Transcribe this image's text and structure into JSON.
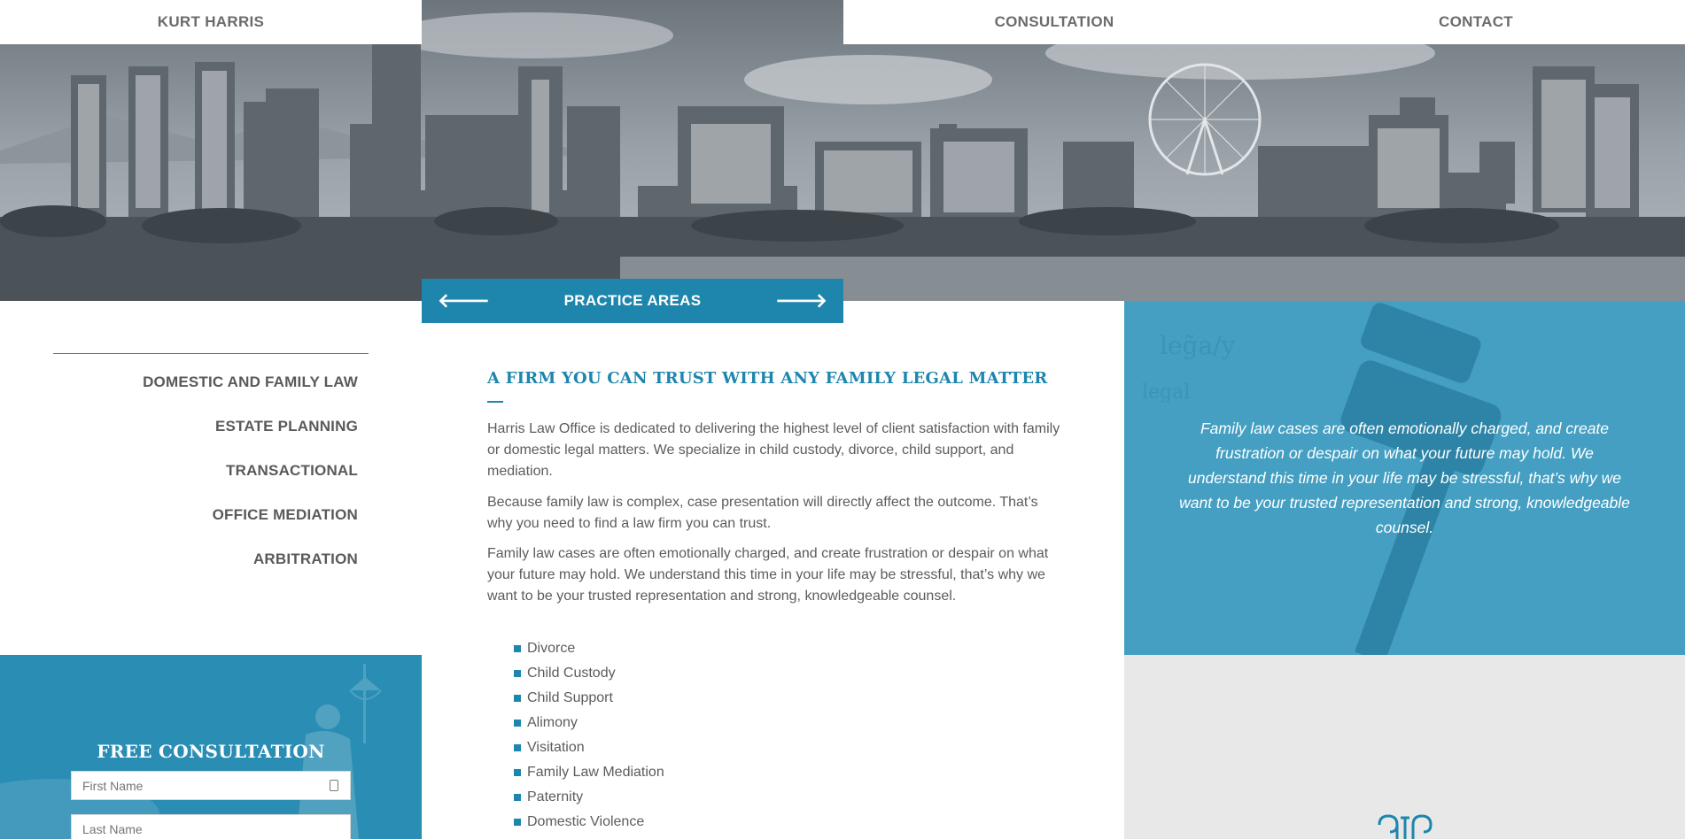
{
  "nav": {
    "brand": "KURT HARRIS",
    "consultation": "CONSULTATION",
    "contact": "CONTACT"
  },
  "practice_bar": {
    "label": "PRACTICE AREAS",
    "prev_icon": "arrow-left-icon",
    "next_icon": "arrow-right-icon"
  },
  "left_menu": {
    "items": [
      {
        "label": "DOMESTIC AND FAMILY LAW"
      },
      {
        "label": "ESTATE PLANNING"
      },
      {
        "label": "TRANSACTIONAL"
      },
      {
        "label": "OFFICE MEDIATION"
      },
      {
        "label": "ARBITRATION"
      }
    ]
  },
  "consultation_form": {
    "title": "FREE CONSULTATION",
    "first_name_placeholder": "First Name",
    "last_name_placeholder": "Last Name"
  },
  "main": {
    "heading": "A FIRM YOU CAN TRUST WITH ANY FAMILY LEGAL MATTER",
    "paragraphs": [
      "Harris Law Office is dedicated to delivering the highest level of client satisfaction with family or domestic legal matters. We specialize in child custody, divorce, child support, and mediation.",
      "Because family law is complex, case presentation will directly affect the outcome. That’s why you need to find a law firm you can trust.",
      "Family law cases are often emotionally charged, and create frustration or despair on what your future may hold. We understand this time in your life may be stressful, that’s why we want to be your trusted representation and strong, knowledgeable counsel."
    ],
    "services": [
      "Divorce",
      "Child Custody",
      "Child Support",
      "Alimony",
      "Visitation",
      "Family Law Mediation",
      "Paternity",
      "Domestic Violence"
    ]
  },
  "quote_panel": {
    "text": "Family law cases are often emotionally charged, and create frustration or despair on what your future may hold. We understand this time in your life may be stressful, that’s why we want to be your trusted representation and strong, knowledgeable counsel."
  },
  "colors": {
    "accent": "#1e86ad",
    "panel_blue": "#2f95bb",
    "text_gray": "#5c5c5c",
    "light_gray": "#e8e8e8"
  }
}
